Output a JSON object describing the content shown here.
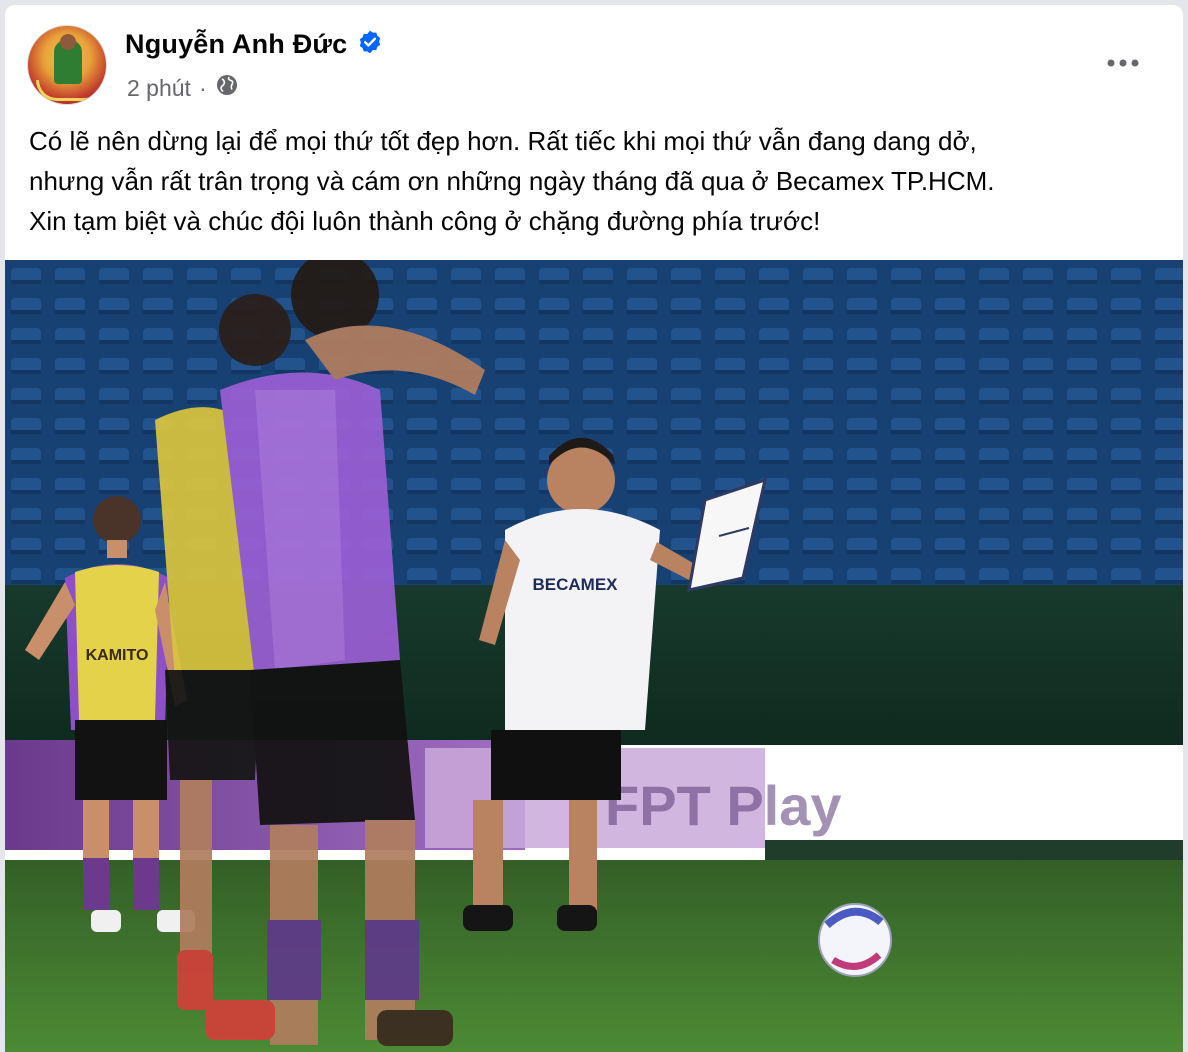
{
  "post": {
    "author_name": "Nguyễn Anh Đức",
    "verified": true,
    "timestamp": "2 phút",
    "separator": "·",
    "privacy_icon": "globe-icon",
    "more_icon": "more-horizontal-icon",
    "text_lines": [
      "Có lẽ nên dừng lại để mọi thứ tốt đẹp hơn. Rất tiếc khi mọi thứ vẫn đang dang dở,",
      "nhưng vẫn rất trân trọng và cám ơn những ngày tháng đã qua ở Becamex TP.HCM.",
      "Xin tạm biệt và chúc đội luôn thành công ở chặng đường phía trước!"
    ],
    "photo": {
      "shirt_text": "BECAMEX",
      "bib_text": "KAMITO",
      "board_text": "FPT Play"
    }
  },
  "colors": {
    "verified_blue": "#0866ff",
    "secondary_text": "#65676b",
    "primary_text": "#050505",
    "stand_blue": "#1c4f8a",
    "pitch_green": "#3f7a2c",
    "purple_kit": "#8e4fc9"
  }
}
